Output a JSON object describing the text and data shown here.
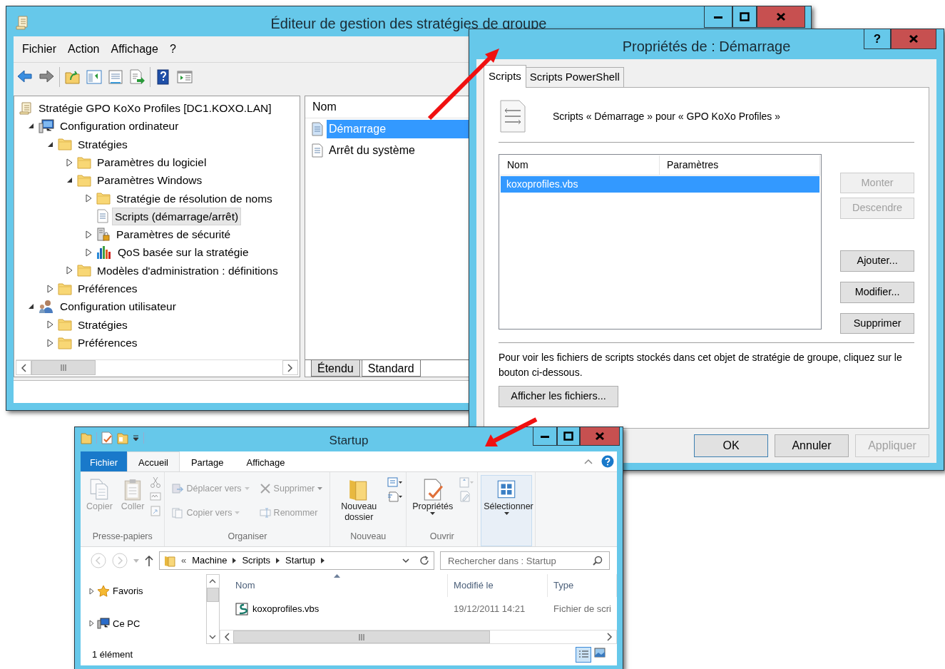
{
  "gpo_editor": {
    "title": "Éditeur de gestion des stratégies de groupe",
    "menu": [
      "Fichier",
      "Action",
      "Affichage",
      "?"
    ],
    "tree": [
      {
        "label": "Stratégie GPO KoXo Profiles [DC1.KOXO.LAN]",
        "kind": "scroll",
        "selected": false,
        "children": [
          {
            "label": "Configuration ordinateur",
            "kind": "computer",
            "expanded": true,
            "selected": false,
            "children": [
              {
                "label": "Stratégies",
                "kind": "folder",
                "expanded": true,
                "selected": false,
                "children": [
                  {
                    "label": "Paramètres du logiciel",
                    "kind": "folder",
                    "expanded": false,
                    "selected": false
                  },
                  {
                    "label": "Paramètres Windows",
                    "kind": "folder",
                    "expanded": true,
                    "selected": false,
                    "children": [
                      {
                        "label": "Stratégie de résolution de noms",
                        "kind": "folder",
                        "expanded": false,
                        "selected": false
                      },
                      {
                        "label": "Scripts (démarrage/arrêt)",
                        "kind": "script",
                        "selected": true
                      },
                      {
                        "label": "Paramètres de sécurité",
                        "kind": "security",
                        "expanded": false,
                        "selected": false
                      },
                      {
                        "label": "QoS basée sur la stratégie",
                        "kind": "chart",
                        "expanded": false,
                        "selected": false
                      }
                    ]
                  },
                  {
                    "label": "Modèles d'administration : définitions",
                    "kind": "folder",
                    "expanded": false,
                    "selected": false
                  }
                ]
              },
              {
                "label": "Préférences",
                "kind": "folder",
                "expanded": false,
                "selected": false
              }
            ]
          },
          {
            "label": "Configuration utilisateur",
            "kind": "user",
            "expanded": true,
            "selected": false,
            "children": [
              {
                "label": "Stratégies",
                "kind": "folder",
                "expanded": false,
                "selected": false
              },
              {
                "label": "Préférences",
                "kind": "folder",
                "expanded": false,
                "selected": false
              }
            ]
          }
        ]
      }
    ],
    "list_column": "Nom",
    "list_items": [
      {
        "label": "Démarrage",
        "selected": true
      },
      {
        "label": "Arrêt du système",
        "selected": false
      }
    ],
    "view_tabs": [
      {
        "label": "Étendu",
        "selected": false
      },
      {
        "label": "Standard",
        "selected": true
      }
    ]
  },
  "properties_dialog": {
    "title": "Propriétés de : Démarrage",
    "help_button": "?",
    "tabs": [
      {
        "label": "Scripts",
        "selected": true
      },
      {
        "label": "Scripts PowerShell",
        "selected": false
      }
    ],
    "heading": "Scripts « Démarrage » pour « GPO KoXo Profiles »",
    "columns": [
      "Nom",
      "Paramètres"
    ],
    "rows": [
      {
        "name": "koxoprofiles.vbs",
        "selected": true
      }
    ],
    "move_buttons": [
      {
        "label": "Monter",
        "disabled": true
      },
      {
        "label": "Descendre",
        "disabled": true
      }
    ],
    "edit_buttons": [
      {
        "label": "Ajouter...",
        "disabled": false
      },
      {
        "label": "Modifier...",
        "disabled": false
      },
      {
        "label": "Supprimer",
        "disabled": false
      }
    ],
    "info_text": "Pour voir les fichiers de scripts stockés dans cet objet de stratégie de groupe, cliquez sur le bouton ci-dessous.",
    "show_files_button": "Afficher les fichiers...",
    "footer_buttons": [
      {
        "label": "OK",
        "disabled": false,
        "default": true
      },
      {
        "label": "Annuler",
        "disabled": false,
        "default": false
      },
      {
        "label": "Appliquer",
        "disabled": true,
        "default": false
      }
    ]
  },
  "explorer": {
    "title": "Startup",
    "ribbon_tabs": [
      {
        "label": "Fichier",
        "kind": "file",
        "selected": false
      },
      {
        "label": "Accueil",
        "kind": "tab",
        "selected": true
      },
      {
        "label": "Partage",
        "kind": "tab",
        "selected": false
      },
      {
        "label": "Affichage",
        "kind": "tab",
        "selected": false
      }
    ],
    "ribbon_groups": [
      {
        "label": "Presse-papiers",
        "items": [
          {
            "kind": "copy",
            "label": "Copier",
            "disabled": true,
            "dropdown": false,
            "hover": false
          },
          {
            "kind": "paste",
            "label": "Coller",
            "disabled": true,
            "dropdown": false,
            "hover": false
          },
          {
            "kind": "clipboard-tools",
            "disabled": true,
            "hover": false
          }
        ]
      },
      {
        "label": "Organiser",
        "items": [
          {
            "kind": "move-to",
            "label": "Déplacer vers",
            "disabled": true,
            "dropdown": true,
            "hover": false
          },
          {
            "kind": "copy-to",
            "label": "Copier vers",
            "disabled": true,
            "dropdown": true,
            "hover": false
          },
          {
            "kind": "delete",
            "label": "Supprimer",
            "disabled": true,
            "dropdown": true,
            "hover": false
          },
          {
            "kind": "rename",
            "label": "Renommer",
            "disabled": true,
            "dropdown": false,
            "hover": false
          }
        ]
      },
      {
        "label": "Nouveau",
        "items": [
          {
            "kind": "new-folder",
            "label": "Nouveau dossier",
            "disabled": false,
            "dropdown": false,
            "hover": false
          },
          {
            "kind": "new-tools",
            "disabled": false,
            "hover": false
          }
        ]
      },
      {
        "label": "Ouvrir",
        "items": [
          {
            "kind": "properties",
            "label": "Propriétés",
            "disabled": false,
            "dropdown": true,
            "hover": false
          },
          {
            "kind": "open-tools",
            "disabled": true,
            "hover": false
          }
        ]
      },
      {
        "items": [
          {
            "kind": "select",
            "label": "Sélectionner",
            "disabled": false,
            "dropdown": true,
            "hover": true
          }
        ]
      }
    ],
    "address": {
      "chevron": "«",
      "crumbs": [
        "Machine",
        "Scripts",
        "Startup"
      ]
    },
    "search": {
      "placeholder": "Rechercher dans : Startup"
    },
    "nav": [
      {
        "label": "Favoris",
        "kind": "favorites",
        "expanded": false
      },
      {
        "label": "Ce PC",
        "kind": "pc",
        "expanded": false
      }
    ],
    "columns": [
      "Nom",
      "Modifié le",
      "Type"
    ],
    "files": [
      {
        "name": "koxoprofiles.vbs",
        "modified": "19/12/2011 14:21",
        "type": "Fichier de scri"
      }
    ],
    "status": "1 élément"
  }
}
